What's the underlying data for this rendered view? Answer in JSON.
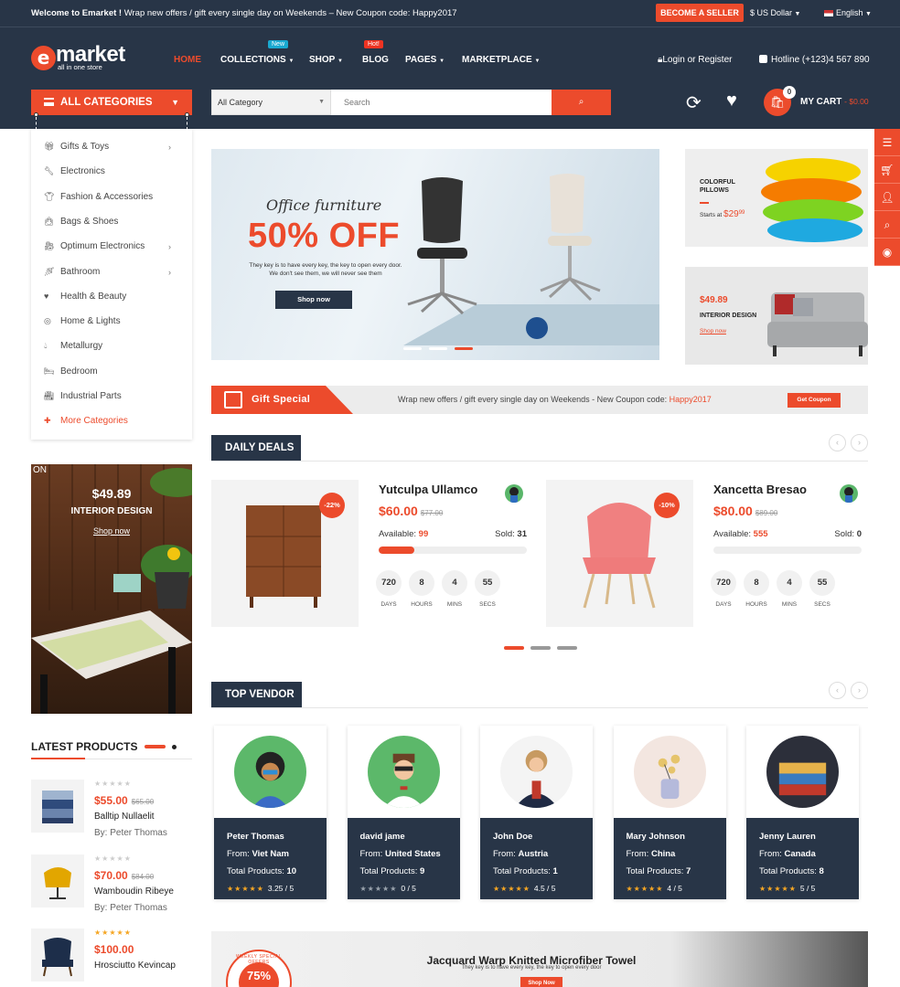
{
  "topbar": {
    "welcome_bold": "Welcome to Emarket !",
    "welcome_text": " Wrap new offers / gift every single day on Weekends – New Coupon code: Happy2017",
    "seller_button": "BECOME A SELLER",
    "currency": "$ US Dollar",
    "language": "English"
  },
  "header": {
    "logo_letter": "e",
    "logo_text": "market",
    "logo_sub": "all in one store",
    "nav": [
      {
        "label": "HOME",
        "active": true
      },
      {
        "label": "COLLECTIONS",
        "badge": "New"
      },
      {
        "label": "SHOP"
      },
      {
        "label": "BLOG",
        "badge": "Hot!"
      },
      {
        "label": "PAGES"
      },
      {
        "label": "MARKETPLACE"
      }
    ],
    "login": "Login or Register",
    "hotline": "Hotline (+123)4 567 890",
    "all_categories": "ALL CATEGORIES",
    "category_select": "All Category",
    "search_placeholder": "Search",
    "cart_count": "0",
    "cart_label": "MY CART",
    "cart_total": "- $0.00"
  },
  "categories": [
    {
      "label": "Gifts & Toys",
      "icon": "gift-icon",
      "has_sub": true
    },
    {
      "label": "Electronics",
      "icon": "electronics-icon",
      "has_sub": false
    },
    {
      "label": "Fashion & Accessories",
      "icon": "fashion-icon",
      "has_sub": false
    },
    {
      "label": "Bags & Shoes",
      "icon": "bag-icon",
      "has_sub": false
    },
    {
      "label": "Optimum Electronics",
      "icon": "camera-icon",
      "has_sub": true
    },
    {
      "label": "Bathroom",
      "icon": "bathroom-icon",
      "has_sub": true
    },
    {
      "label": "Health & Beauty",
      "icon": "heart-icon",
      "has_sub": false
    },
    {
      "label": "Home & Lights",
      "icon": "light-icon",
      "has_sub": false
    },
    {
      "label": "Metallurgy",
      "icon": "drop-icon",
      "has_sub": false
    },
    {
      "label": "Bedroom",
      "icon": "bed-icon",
      "has_sub": false
    },
    {
      "label": "Industrial Parts",
      "icon": "factory-icon",
      "has_sub": false
    },
    {
      "label": "More Categories",
      "icon": "plus-icon",
      "has_sub": false
    }
  ],
  "hero": {
    "script_title": "Office furniture",
    "headline": "50% OFF",
    "subtext_1": "They key is to have every key, the key to open every door.",
    "subtext_2": "We don't see them, we will never see them",
    "button": "Shop now"
  },
  "side_banners": {
    "pillows_title_1": "COLORFUL",
    "pillows_title_2": "PILLOWS",
    "pillows_starts": "Starts at ",
    "pillows_price": "$29",
    "pillows_cents": "99",
    "sofa_price": "$49.89",
    "sofa_title": "INTERIOR DESIGN",
    "sofa_shop": "Shop now"
  },
  "gift_bar": {
    "label": "Gift Special",
    "message": "Wrap new offers / gift every single day on Weekends - New Coupon code: ",
    "code": "Happy2017",
    "button": "Get Coupon"
  },
  "daily_deals": {
    "title": "DAILY DEALS",
    "items": [
      {
        "name": "Yutculpa Ullamco",
        "price": "$60.00",
        "old_price": "$77.00",
        "discount": "-22%",
        "available_label": "Available:",
        "available": "99",
        "sold_label": "Sold:",
        "sold": "31",
        "progress": 0.24,
        "countdown": [
          {
            "v": "720",
            "l": "DAYS"
          },
          {
            "v": "8",
            "l": "HOURS"
          },
          {
            "v": "4",
            "l": "MINS"
          },
          {
            "v": "55",
            "l": "SECS"
          }
        ]
      },
      {
        "name": "Xancetta Bresao",
        "price": "$80.00",
        "old_price": "$89.00",
        "discount": "-10%",
        "available_label": "Available:",
        "available": "555",
        "sold_label": "Sold:",
        "sold": "0",
        "progress": 0,
        "countdown": [
          {
            "v": "720",
            "l": "DAYS"
          },
          {
            "v": "8",
            "l": "HOURS"
          },
          {
            "v": "4",
            "l": "MINS"
          },
          {
            "v": "55",
            "l": "SECS"
          }
        ]
      }
    ]
  },
  "promo": {
    "corner": "ON",
    "price": "$49.89",
    "title": "INTERIOR DESIGN",
    "link": "Shop now"
  },
  "latest_products": {
    "title": "LATEST PRODUCTS",
    "items": [
      {
        "price": "$55.00",
        "old_price": "$65.00",
        "name": "Balltip Nullaelit",
        "by": "By: Peter Thomas",
        "rating": 0
      },
      {
        "price": "$70.00",
        "old_price": "$84.00",
        "name": "Wamboudin Ribeye",
        "by": "By: Peter Thomas",
        "rating": 0
      },
      {
        "price": "$100.00",
        "old_price": "",
        "name": "Hrosciutto Kevincap",
        "by": "",
        "rating": 5
      }
    ]
  },
  "top_vendor": {
    "title": "TOP VENDOR",
    "from_label": "From: ",
    "total_label": "Total Products: ",
    "vendors": [
      {
        "name": "Peter Thomas",
        "from": "Viet Nam",
        "total": "10",
        "rating": 5,
        "score": "3.25 / 5"
      },
      {
        "name": "david jame",
        "from": "United States",
        "total": "9",
        "rating": 0,
        "score": "0 / 5"
      },
      {
        "name": "John Doe",
        "from": "Austria",
        "total": "1",
        "rating": 5,
        "score": "4.5 / 5"
      },
      {
        "name": "Mary Johnson",
        "from": "China",
        "total": "7",
        "rating": 5,
        "score": "4 / 5"
      },
      {
        "name": "Jenny Lauren",
        "from": "Canada",
        "total": "8",
        "rating": 5,
        "score": "5 / 5"
      }
    ]
  },
  "bottom_banner": {
    "title": "Jacquard Warp Knitted Microfiber Towel",
    "sub": "They key is to have every key, the key to open every door",
    "button": "Shop Now",
    "badge_pct": "75%",
    "badge_ring": "WEEKLY SPECIAL OFFERS"
  },
  "colors": {
    "accent": "#ec4b2c",
    "dark": "#283547"
  }
}
